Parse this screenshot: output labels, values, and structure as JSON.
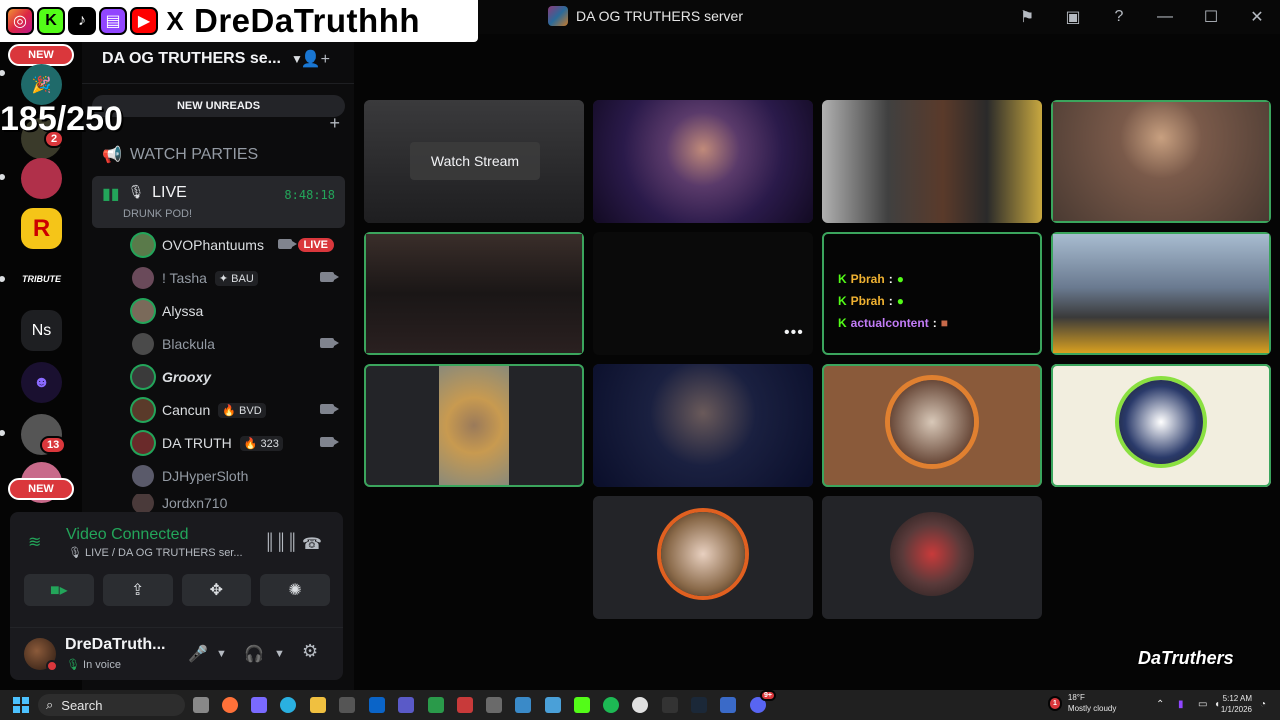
{
  "overlay": {
    "handle": "DreDaTruthhh",
    "socials": [
      "instagram-icon",
      "kick-icon",
      "tiktok-icon",
      "twitch-icon",
      "youtube-icon",
      "x-icon"
    ],
    "counter": "185/250"
  },
  "window": {
    "title": "DA OG TRUTHERS server",
    "icons": [
      "flag-icon",
      "inbox-icon",
      "help-icon",
      "minimize-icon",
      "maximize-icon",
      "close-icon"
    ]
  },
  "rail": {
    "new_top": "NEW",
    "new_bottom": "NEW",
    "badge_1": "2",
    "badge_2": "13",
    "tribute": "TRIBUTE",
    "ns": "Ns",
    "rockstar": "R"
  },
  "sidebar": {
    "server_name": "DA OG TRUTHERS se...",
    "new_unreads": "NEW UNREADS",
    "watch_parties": "WATCH PARTIES",
    "live_channel": {
      "name": "LIVE",
      "timer": "8:48:18",
      "status": "DRUNK POD!"
    },
    "members": [
      {
        "name": "OVOPhantuums",
        "tag": "",
        "live": "LIVE",
        "color": "#5a7a4a"
      },
      {
        "name": "! Tasha",
        "tag": "BAU",
        "live": "",
        "color": "#6a4a5a"
      },
      {
        "name": "Alyssa",
        "tag": "",
        "live": "",
        "color": "#7a6a5a"
      },
      {
        "name": "Blackula",
        "tag": "",
        "live": "",
        "color": "#4a4a4a"
      },
      {
        "name": "Grooxy",
        "tag": "",
        "live": "",
        "color": "#3a3a3a"
      },
      {
        "name": "Cancun",
        "tag": "BVD",
        "live": "",
        "color": "#5a3a2a"
      },
      {
        "name": "DA TRUTH",
        "tag": "323",
        "live": "",
        "color": "#6a2a2a"
      },
      {
        "name": "DJHyperSloth",
        "tag": "",
        "live": "",
        "color": "#5a5a6a"
      },
      {
        "name": "Jordxn710",
        "tag": "",
        "live": "",
        "color": "#4a3a3a"
      }
    ]
  },
  "voice": {
    "status": "Video Connected",
    "location": "LIVE / DA OG TRUTHERS ser...",
    "user_name": "DreDaTruth...",
    "user_status": "In voice"
  },
  "stage": {
    "watch_stream": "Watch Stream",
    "chat": [
      {
        "user": "Pbrah",
        "color": "#f0b232"
      },
      {
        "user": "Pbrah",
        "color": "#f0b232"
      },
      {
        "user": "actualcontent",
        "color": "#c27cf7"
      }
    ],
    "more": "•••",
    "corner_logo": "DaTruthers"
  },
  "taskbar": {
    "search": "Search",
    "weather_temp": "18°F",
    "weather_desc": "Mostly cloudy",
    "weather_badge": "1",
    "time": "5:12 AM",
    "date": "1/1/2026",
    "discord_badge": "9+"
  },
  "colors": {
    "accent_green": "#23a55a",
    "danger_red": "#da373c",
    "speaking_border": "#3ba55d"
  }
}
